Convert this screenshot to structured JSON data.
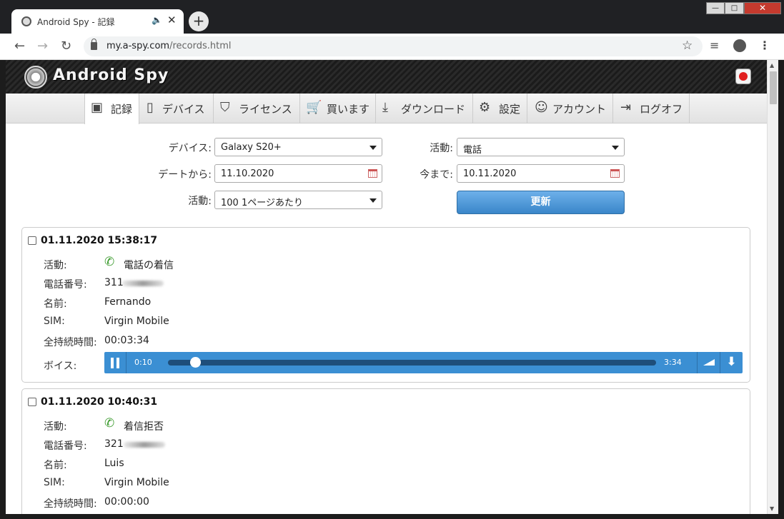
{
  "browser": {
    "tab_title": "Android Spy - 記録",
    "url_host": "my.a-spy.com",
    "url_path": "/records.html",
    "minimize": "—",
    "maximize": "□",
    "close": "✕",
    "new_tab": "+"
  },
  "site": {
    "logo_text": "Android Spy",
    "accent": "#3b8fd3",
    "nav": [
      {
        "label": "記録",
        "icon": "monitor-play-icon",
        "active": true
      },
      {
        "label": "デバイス",
        "icon": "smartphone-icon"
      },
      {
        "label": "ライセンス",
        "icon": "shield-check-icon"
      },
      {
        "label": "買います",
        "icon": "cart-icon"
      },
      {
        "label": "ダウンロード",
        "icon": "download-icon"
      },
      {
        "label": "設定",
        "icon": "gear-icon"
      },
      {
        "label": "アカウント",
        "icon": "user-icon"
      },
      {
        "label": "ログオフ",
        "icon": "logout-icon"
      }
    ]
  },
  "filters": {
    "device_label": "デバイス:",
    "device_value": "Galaxy S20+",
    "activity_label": "活動:",
    "activity_value": "電話",
    "date_from_label": "デートから:",
    "date_from_value": "11.10.2020",
    "date_to_label": "今まで:",
    "date_to_value": "10.11.2020",
    "per_page_label": "活動:",
    "per_page_value": "100 1ページあたり",
    "update_button": "更新"
  },
  "record_labels": {
    "activity": "活動:",
    "phone": "電話番号:",
    "name": "名前:",
    "sim": "SIM:",
    "duration": "全持続時間:",
    "voice": "ボイス:"
  },
  "records": [
    {
      "timestamp": "01.11.2020 15:38:17",
      "activity": "電話の着信",
      "phone_visible": "311",
      "name": "Fernando",
      "sim": "Virgin Mobile",
      "duration": "00:03:34",
      "player": {
        "current": "0:10",
        "total": "3:34",
        "progress": 0.047
      }
    },
    {
      "timestamp": "01.11.2020 10:40:31",
      "activity": "着信拒否",
      "phone_visible": "321",
      "name": "Luis",
      "sim": "Virgin Mobile",
      "duration": "00:00:00"
    }
  ]
}
